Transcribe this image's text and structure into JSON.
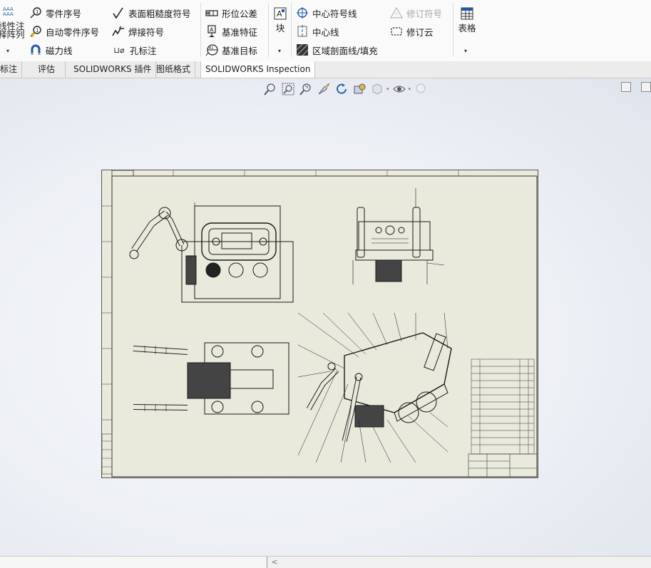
{
  "ribbon": {
    "group1": {
      "aaa_text": "AAA\nAAA",
      "label_line1": "线性注",
      "label_line2": "释阵列"
    },
    "balloon": "零件序号",
    "auto_balloon": "自动零件序号",
    "magnetic_line": "磁力线",
    "surface_finish": "表面粗糙度符号",
    "weld_symbol": "焊接符号",
    "hole_callout": "孔标注",
    "hole_prefix": "⊔⌀",
    "geometric_tolerance": "形位公差",
    "datum_feature": "基准特征",
    "datum_target": "基准目标",
    "block": "块",
    "center_mark": "中心符号线",
    "centerline": "中心线",
    "area_hatch": "区域剖面线/填充",
    "revision_symbol": "修订符号",
    "revision_cloud": "修订云",
    "table": "表格",
    "caret": "▾"
  },
  "tabs": [
    {
      "label": "标注"
    },
    {
      "label": "评估"
    },
    {
      "label": "SOLIDWORKS 插件"
    },
    {
      "label": "图纸格式"
    },
    {
      "label": "SOLIDWORKS Inspection"
    }
  ],
  "hud": {
    "icons": [
      "zoom-to-fit",
      "zoom-to-area",
      "zoom-previous",
      "zoom-in-out",
      "rotate",
      "pan",
      "display-style",
      "hide-show",
      "appearance"
    ]
  },
  "statusbar": {
    "scroll_arrow": "<"
  },
  "colors": {
    "sheet_bg": "#e9e9dc",
    "line": "#1a1a1a",
    "accent_blue": "#1e5aa8",
    "disabled": "#a8a8a8"
  }
}
